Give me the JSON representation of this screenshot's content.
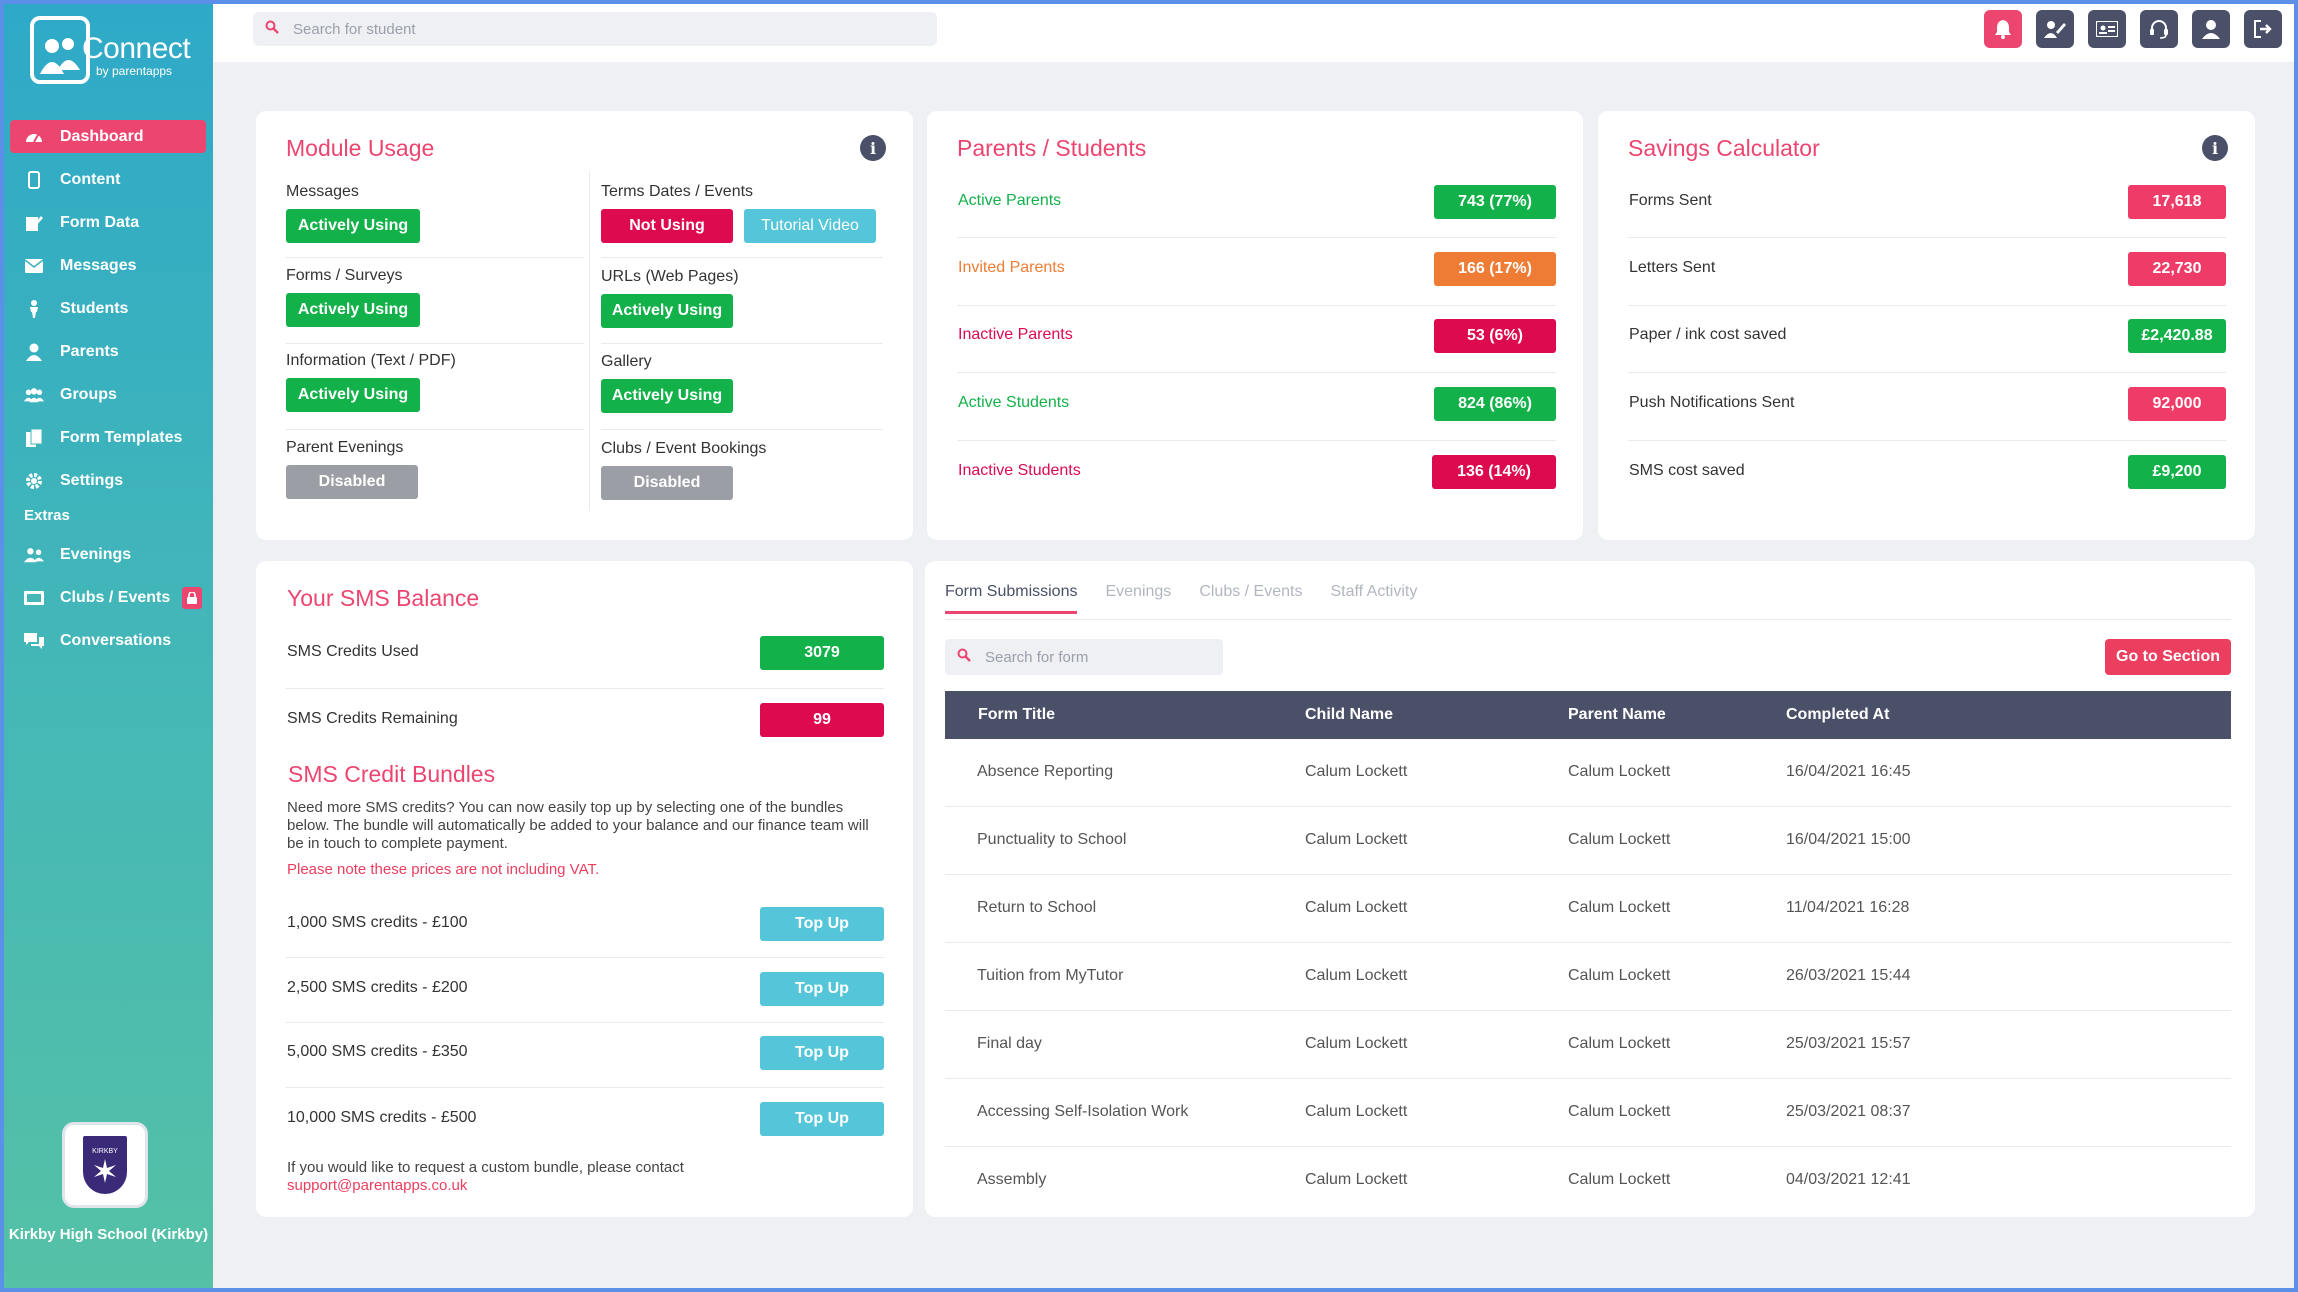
{
  "app": {
    "logo_text": "Connect",
    "logo_sub": "by parentapps"
  },
  "search": {
    "placeholder": "Search for student"
  },
  "sidebar": {
    "items": [
      {
        "label": "Dashboard",
        "icon": "dashboard-icon"
      },
      {
        "label": "Content",
        "icon": "phone-icon"
      },
      {
        "label": "Form Data",
        "icon": "edit-icon"
      },
      {
        "label": "Messages",
        "icon": "envelope-icon"
      },
      {
        "label": "Students",
        "icon": "student-icon"
      },
      {
        "label": "Parents",
        "icon": "user-icon"
      },
      {
        "label": "Groups",
        "icon": "users-icon"
      },
      {
        "label": "Form Templates",
        "icon": "copy-icon"
      },
      {
        "label": "Settings",
        "icon": "gear-icon"
      }
    ],
    "extras_label": "Extras",
    "extras": [
      {
        "label": "Evenings",
        "icon": "users-icon"
      },
      {
        "label": "Clubs / Events",
        "icon": "ticket-icon"
      },
      {
        "label": "Conversations",
        "icon": "chat-icon"
      }
    ],
    "school_name": "Kirkby High School (Kirkby)",
    "crest_text": "KIRKBY"
  },
  "module_usage": {
    "title": "Module Usage",
    "modules": [
      {
        "name": "Messages",
        "status": "Actively Using"
      },
      {
        "name": "Terms Dates / Events",
        "status": "Not Using",
        "extra": "Tutorial Video"
      },
      {
        "name": "Forms / Surveys",
        "status": "Actively Using"
      },
      {
        "name": "URLs (Web Pages)",
        "status": "Actively Using"
      },
      {
        "name": "Information (Text / PDF)",
        "status": "Actively Using"
      },
      {
        "name": "Gallery",
        "status": "Actively Using"
      },
      {
        "name": "Parent Evenings",
        "status": "Disabled"
      },
      {
        "name": "Clubs / Event Bookings",
        "status": "Disabled"
      }
    ]
  },
  "parents_students": {
    "title": "Parents / Students",
    "rows": [
      {
        "label": "Active Parents",
        "value": "743 (77%)"
      },
      {
        "label": "Invited Parents",
        "value": "166 (17%)"
      },
      {
        "label": "Inactive Parents",
        "value": "53 (6%)"
      },
      {
        "label": "Active Students",
        "value": "824 (86%)"
      },
      {
        "label": "Inactive Students",
        "value": "136 (14%)"
      }
    ],
    "colors": {
      "active": "#13b14a",
      "invited": "#ef7c34",
      "inactive": "#dd0a4f"
    }
  },
  "savings": {
    "title": "Savings Calculator",
    "rows": [
      {
        "label": "Forms Sent",
        "value": "17,618"
      },
      {
        "label": "Letters Sent",
        "value": "22,730"
      },
      {
        "label": "Paper / ink cost saved",
        "value": "£2,420.88"
      },
      {
        "label": "Push Notifications Sent",
        "value": "92,000"
      },
      {
        "label": "SMS cost saved",
        "value": "£9,200"
      }
    ]
  },
  "sms": {
    "title": "Your SMS Balance",
    "used_label": "SMS Credits Used",
    "used_value": "3079",
    "remaining_label": "SMS Credits Remaining",
    "remaining_value": "99",
    "bundles_title": "SMS Credit Bundles",
    "bundles_desc": "Need more SMS credits? You can now easily top up by selecting one of the bundles below. The bundle will automatically be added to your balance and our finance team will be in touch to complete payment.",
    "vat_note": "Please note these prices are not including VAT.",
    "bundles": [
      {
        "label": "1,000 SMS credits - £100",
        "button": "Top Up"
      },
      {
        "label": "2,500 SMS credits - £200",
        "button": "Top Up"
      },
      {
        "label": "5,000 SMS credits - £350",
        "button": "Top Up"
      },
      {
        "label": "10,000 SMS credits - £500",
        "button": "Top Up"
      }
    ],
    "custom_text": "If you would like to request a custom bundle, please contact",
    "email": "support@parentapps.co.uk"
  },
  "submissions": {
    "tabs": [
      "Form Submissions",
      "Evenings",
      "Clubs / Events",
      "Staff Activity"
    ],
    "search_placeholder": "Search for form",
    "goto_label": "Go to Section",
    "columns": [
      "Form Title",
      "Child Name",
      "Parent Name",
      "Completed At"
    ],
    "rows": [
      [
        "Absence Reporting",
        "Calum Lockett",
        "Calum Lockett",
        "16/04/2021 16:45"
      ],
      [
        "Punctuality to School",
        "Calum Lockett",
        "Calum Lockett",
        "16/04/2021 15:00"
      ],
      [
        "Return to School",
        "Calum Lockett",
        "Calum Lockett",
        "11/04/2021 16:28"
      ],
      [
        "Tuition from MyTutor",
        "Calum Lockett",
        "Calum Lockett",
        "26/03/2021 15:44"
      ],
      [
        "Final day",
        "Calum Lockett",
        "Calum Lockett",
        "25/03/2021 15:57"
      ],
      [
        "Accessing Self-Isolation Work",
        "Calum Lockett",
        "Calum Lockett",
        "25/03/2021 08:37"
      ],
      [
        "Assembly",
        "Calum Lockett",
        "Calum Lockett",
        "04/03/2021 12:41"
      ]
    ]
  }
}
